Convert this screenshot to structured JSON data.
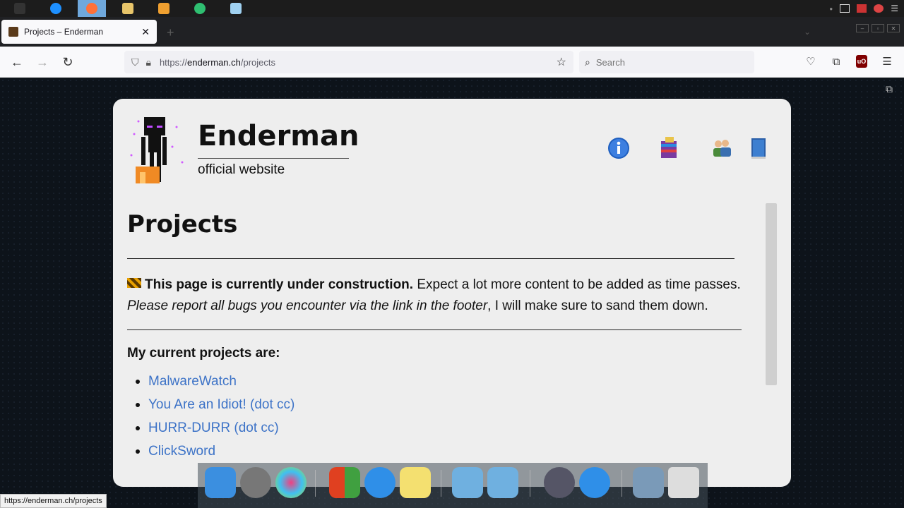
{
  "taskbar": {
    "apps": [
      "app-1",
      "ie",
      "firefox",
      "explorer",
      "media-player",
      "edge",
      "notepad"
    ]
  },
  "browser": {
    "tab_title": "Projects – Enderman",
    "tab_close": "✕",
    "new_tab": "+",
    "url_host": "enderman.ch",
    "url_prefix": "https://",
    "url_path": "/projects",
    "search_placeholder": "Search"
  },
  "site": {
    "brand": "Enderman",
    "tagline": "official website",
    "nav_icons": [
      "info-icon",
      "projects-icon",
      "users-icon",
      "book-icon"
    ]
  },
  "page": {
    "title": "Projects",
    "notice_bold": "This page is currently under construction.",
    "notice_rest": " Expect a lot more content to be added as time passes.",
    "notice_italic": "Please report all bugs you encounter via the link in the footer",
    "notice_end": ", I will make sure to sand them down.",
    "subheading": "My current projects are:",
    "projects": [
      "MalwareWatch",
      "You Are an Idiot! (dot cc)",
      "HURR-DURR (dot cc)",
      "ClickSword"
    ]
  },
  "status_bar": {
    "url": "https://enderman.ch/projects"
  },
  "colors": {
    "link": "#3d73c7",
    "card_bg": "#eeeeee",
    "page_bg": "#0d131a"
  }
}
